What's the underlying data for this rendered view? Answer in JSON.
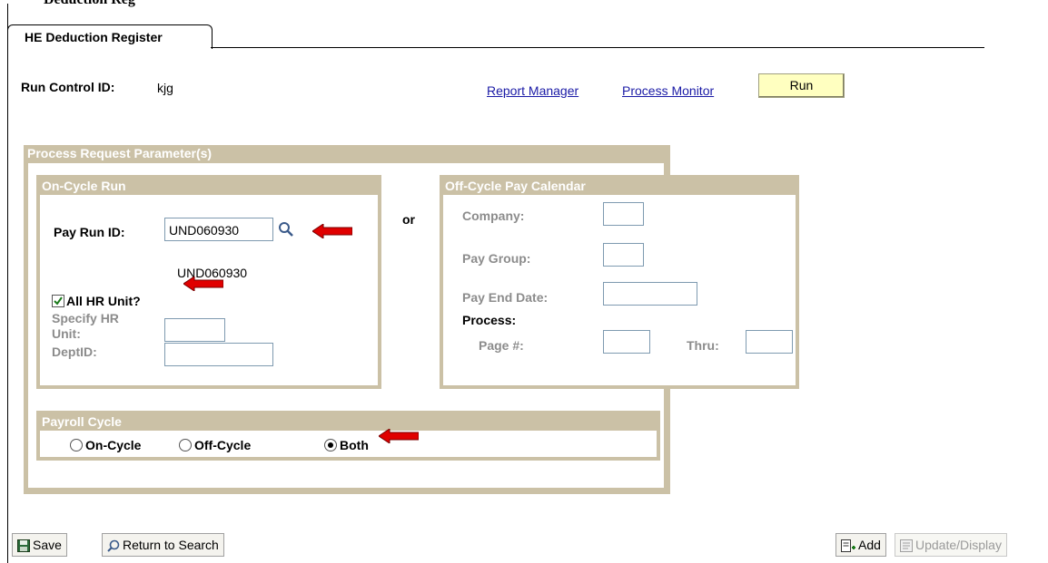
{
  "page_heading": "Deduction Reg",
  "tab": {
    "label": "HE Deduction Register"
  },
  "run_control": {
    "label": "Run Control ID:",
    "value": "kjg"
  },
  "links": {
    "report_manager": "Report Manager",
    "process_monitor": "Process Monitor"
  },
  "run_button": "Run",
  "process_params": {
    "title": "Process Request Parameter(s)",
    "or_label": "or"
  },
  "on_cycle": {
    "title": "On-Cycle Run",
    "pay_run_label": "Pay Run ID:",
    "pay_run_value": "UND060930",
    "pay_run_desc": "UND060930",
    "all_hr_unit_label": "All HR Unit?",
    "all_hr_unit_checked": true,
    "specify_hr_unit_label_1": "Specify HR",
    "specify_hr_unit_label_2": "Unit:",
    "deptid_label": "DeptID:"
  },
  "off_cycle": {
    "title": "Off-Cycle Pay Calendar",
    "company_label": "Company:",
    "pay_group_label": "Pay Group:",
    "pay_end_date_label": "Pay End Date:",
    "process_label": "Process:",
    "page_label": "Page #:",
    "thru_label": "Thru:"
  },
  "payroll_cycle": {
    "title": "Payroll Cycle",
    "options": [
      "On-Cycle",
      "Off-Cycle",
      "Both"
    ],
    "selected": "Both"
  },
  "toolbar": {
    "save": "Save",
    "return_to_search": "Return to Search",
    "add": "Add",
    "update_display": "Update/Display"
  },
  "colors": {
    "group_bg": "#cbc1a6",
    "run_button": "#ffffc0",
    "link": "#1a1aa6",
    "annotation_arrow": "#e00000"
  },
  "icons": [
    "lookup-icon",
    "checkbox-icon",
    "save-icon",
    "search-icon",
    "add-icon",
    "update-display-icon",
    "annotation-arrow-icon"
  ]
}
